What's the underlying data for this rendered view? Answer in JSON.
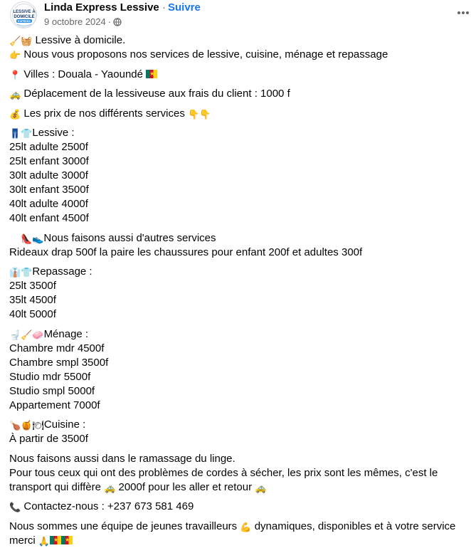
{
  "post": {
    "author": "Linda Express Lessive",
    "separator": "·",
    "follow_label": "Suivre",
    "date": "9 octobre 2024",
    "date_dot": "·",
    "avatar_logo_text": "LESSIVE À DOMICILE EXPRESS"
  },
  "body": {
    "p1": {
      "l1": {
        "emoji": "🧹🧺",
        "text": " Lessive à domicile."
      },
      "l2": {
        "emoji": "👉",
        "text": " Nous vous proposons nos services de lessive, cuisine, ménage et repassage"
      }
    },
    "p2": {
      "emoji": "📍",
      "text": " Villes : Douala - Yaoundé "
    },
    "p3": {
      "emoji": "🚕",
      "text": " Déplacement de la lessiveuse aux frais du client : 1000 f"
    },
    "p4": {
      "emoji": "💰",
      "text": " Les prix de nos différents services ",
      "emoji_end": "👇👇"
    },
    "p5": {
      "head": {
        "emoji": "👖👕",
        "text": "Lessive :"
      },
      "items": [
        "25lt adulte 2500f",
        "25lt enfant 3000f",
        "30lt adulte 3000f",
        "30lt enfant 3500f",
        "40lt adulte 4000f",
        "40lt enfant 4500f"
      ]
    },
    "p6": {
      "head": {
        "emoji": "👠👟",
        "text": "Nous faisons aussi d'autres services"
      },
      "line2": "Rideaux drap 500f la paire les chaussures pour enfant 200f et adultes 300f"
    },
    "p7": {
      "head": {
        "emoji": "👔👕",
        "text": "Repassage :"
      },
      "items": [
        "25lt 3500f",
        "35lt 4500f",
        "40lt 5000f"
      ]
    },
    "p8": {
      "head": {
        "emoji": "🚽🧹🧼",
        "text": "Ménage :"
      },
      "items": [
        "Chambre mdr 4500f",
        "Chambre smpl 3500f",
        "Studio mdr 5500f",
        "Studio smpl 5000f",
        "Appartement 7000f"
      ]
    },
    "p9": {
      "head": {
        "emoji": "🍗🍯🍽",
        "text": "Cuisine :"
      },
      "items": [
        "À partir de 3500f"
      ]
    },
    "p10": {
      "l1": "Nous faisons aussi dans le ramassage du linge.",
      "l2": "Pour tous ceux qui ont des problèmes de cordes à sécher, les prix sont les mêmes, c'est le",
      "l3a": "transport qui diffère ",
      "l3_emoji": "🚕",
      "l3b": " 2000f pour les aller et retour ",
      "l3_emoji2": "🚕"
    },
    "p11": {
      "emoji": "📞",
      "text": " Contactez-nous : +237 673 581 469"
    },
    "p12": {
      "l1a": "Nous sommes une équipe de jeunes travailleurs ",
      "l1_emoji": "💪",
      "l1b": " dynamiques, disponibles et à votre service",
      "l2": "merci ",
      "l2_emoji": "🙏"
    }
  }
}
